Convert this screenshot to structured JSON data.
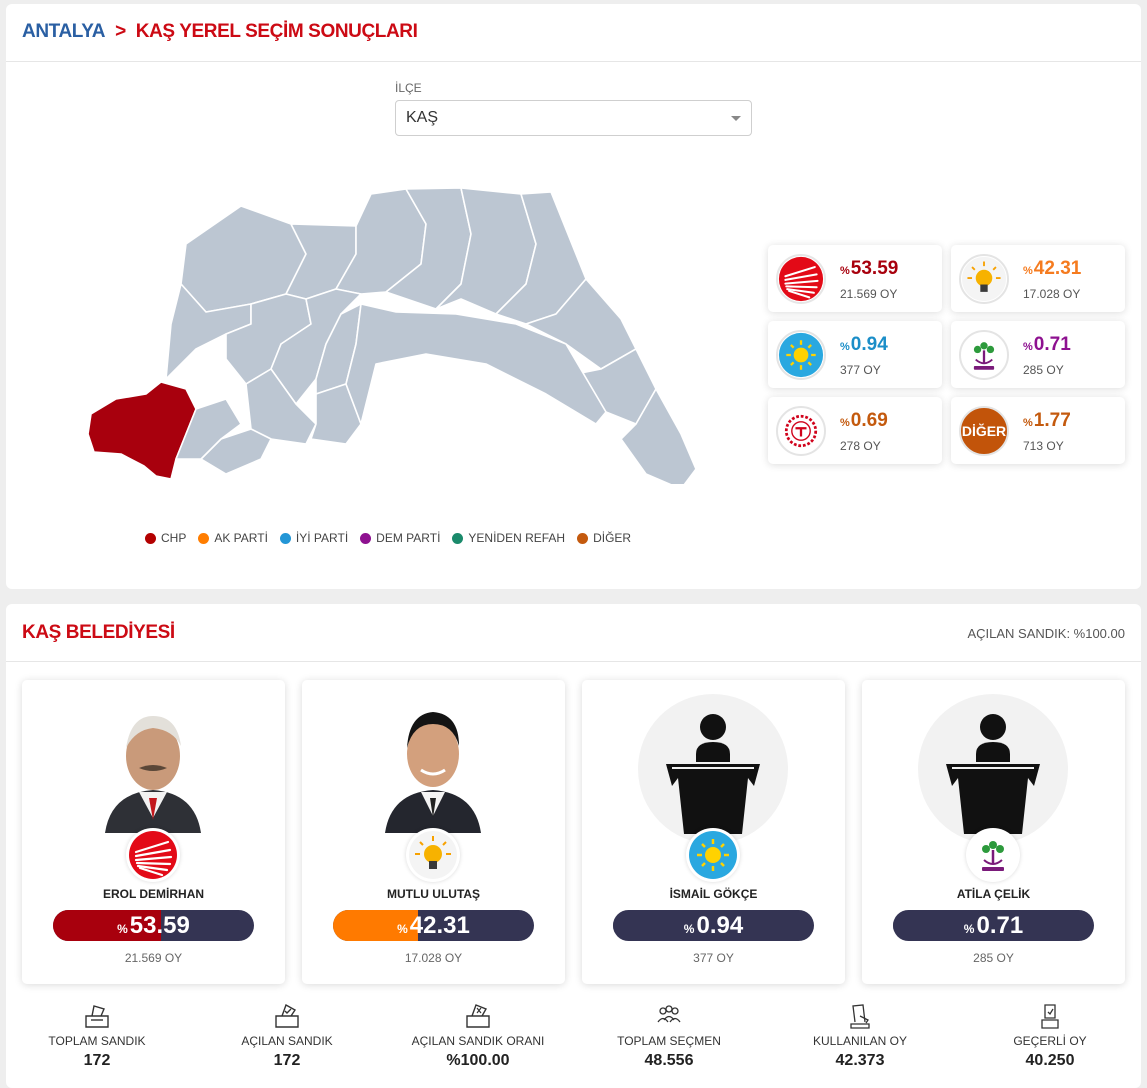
{
  "breadcrumb": {
    "province": "ANTALYA",
    "separator": ">",
    "page": "KAŞ YEREL SEÇİM SONUÇLARI"
  },
  "district": {
    "label": "İLÇE",
    "selected": "KAŞ"
  },
  "legend": [
    {
      "label": "CHP",
      "color": "#b30000"
    },
    {
      "label": "AK PARTİ",
      "color": "#ff7d00"
    },
    {
      "label": "İYİ PARTİ",
      "color": "#2396d6"
    },
    {
      "label": "DEM PARTİ",
      "color": "#8e1190"
    },
    {
      "label": "YENİDEN REFAH",
      "color": "#1a8a6b"
    },
    {
      "label": "DİĞER",
      "color": "#c45a0e"
    }
  ],
  "party_results": [
    {
      "party": "CHP",
      "pct_prefix": "%",
      "pct": "53.59",
      "votes": "21.569 OY",
      "color": "#a8000d",
      "icon": "chp-logo"
    },
    {
      "party": "AK PARTİ",
      "pct_prefix": "%",
      "pct": "42.31",
      "votes": "17.028 OY",
      "color": "#f57b1f",
      "icon": "akp-logo"
    },
    {
      "party": "İYİ PARTİ",
      "pct_prefix": "%",
      "pct": "0.94",
      "votes": "377 OY",
      "color": "#1b8ec8",
      "icon": "iyi-logo"
    },
    {
      "party": "DEM PARTİ",
      "pct_prefix": "%",
      "pct": "0.71",
      "votes": "285 OY",
      "color": "#8e1190",
      "icon": "dem-logo"
    },
    {
      "party": "TİP",
      "pct_prefix": "%",
      "pct": "0.69",
      "votes": "278 OY",
      "color": "#c45a0e",
      "icon": "tip-logo"
    },
    {
      "party": "DİĞER",
      "pct_prefix": "%",
      "pct": "1.77",
      "votes": "713 OY",
      "color": "#c45a0e",
      "icon": "diger-logo",
      "logo_text": "DİĞER"
    }
  ],
  "municipality": {
    "title": "KAŞ BELEDİYESİ",
    "opened_ballots": "AÇILAN SANDIK: %100.00"
  },
  "candidates": [
    {
      "name": "EROL DEMİRHAN",
      "pct_prefix": "%",
      "pct": "53.59",
      "pct_value": 53.59,
      "votes": "21.569 OY",
      "party": "CHP",
      "fill_color": "#a8000d"
    },
    {
      "name": "MUTLU ULUTAŞ",
      "pct_prefix": "%",
      "pct": "42.31",
      "pct_value": 42.31,
      "votes": "17.028 OY",
      "party": "AK PARTİ",
      "fill_color": "#ff7a00"
    },
    {
      "name": "İSMAİL GÖKÇE",
      "pct_prefix": "%",
      "pct": "0.94",
      "pct_value": 0.94,
      "votes": "377 OY",
      "party": "İYİ PARTİ",
      "fill_color": "#343453"
    },
    {
      "name": "ATİLA ÇELİK",
      "pct_prefix": "%",
      "pct": "0.71",
      "pct_value": 0.71,
      "votes": "285 OY",
      "party": "DEM PARTİ",
      "fill_color": "#343453"
    }
  ],
  "stats": [
    {
      "label": "TOPLAM SANDIK",
      "value": "172",
      "icon": "ballot-box-icon"
    },
    {
      "label": "AÇILAN SANDIK",
      "value": "172",
      "icon": "opened-ballot-icon"
    },
    {
      "label": "AÇILAN SANDIK ORANI",
      "value": "%100.00",
      "icon": "ballot-rate-icon"
    },
    {
      "label": "TOPLAM SEÇMEN",
      "value": "48.556",
      "icon": "voters-icon"
    },
    {
      "label": "KULLANILAN OY",
      "value": "42.373",
      "icon": "vote-cast-icon"
    },
    {
      "label": "GEÇERLİ OY",
      "value": "40.250",
      "icon": "valid-vote-icon"
    }
  ],
  "map": {
    "highlight_color": "#a8000d",
    "base_color": "#bcc6d2",
    "highlighted_district": "KAŞ"
  }
}
